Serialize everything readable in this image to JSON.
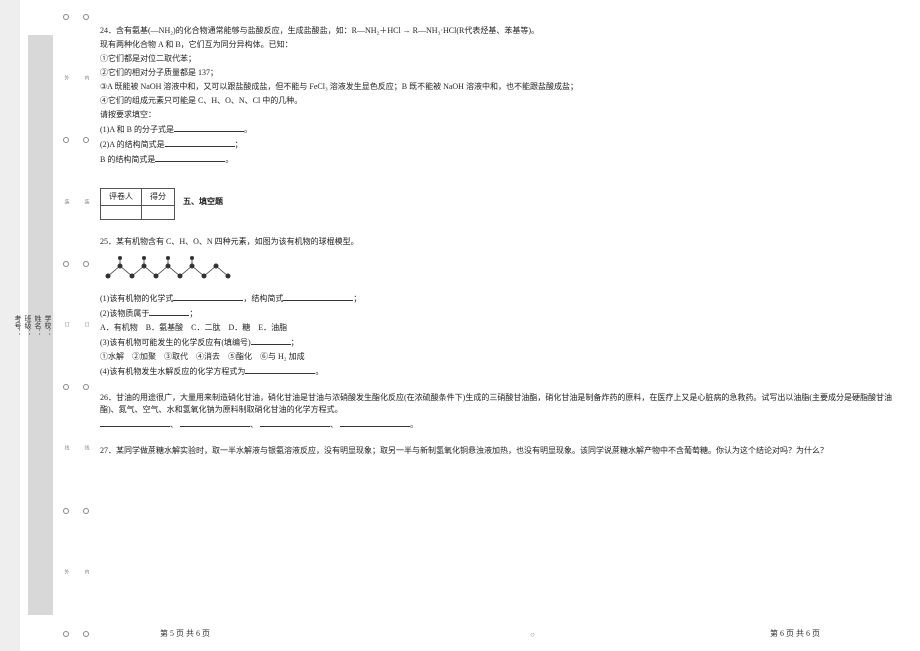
{
  "margin_labels": {
    "school": "学校：",
    "name": "姓名：",
    "class": "班级：",
    "exam_no": "考号：",
    "fold_outer": "外",
    "fold_inner": "内",
    "cut_1": "装",
    "cut_2": "订",
    "cut_3": "线"
  },
  "q24": {
    "num": "24．",
    "stem1": "含有氨基(—NH₂)的化合物通常能够与盐酸反应，生成盐酸盐，如：R—NH₂＋HCl → R—NH₃·HCl(R代表烃基、苯基等)。",
    "stem2": "现有两种化合物 A 和 B，它们互为同分异构体。已知：",
    "c1": "①它们都是对位二取代苯；",
    "c2": "②它们的相对分子质量都是 137；",
    "c3": "③A 既能被 NaOH 溶液中和，又可以跟盐酸成盐，但不能与 FeCl₃ 溶液发生显色反应；B 既不能被 NaOH 溶液中和，也不能跟盐酸成盐；",
    "c4": "④它们的组成元素只可能是 C、H、O、N、Cl 中的几种。",
    "ask": "请按要求填空：",
    "p1": "(1)A 和 B 的分子式是",
    "p2a": "(2)A 的结构简式是",
    "p2b": "B 的结构简式是",
    "end": "。",
    "semi": "；"
  },
  "section5": {
    "reviewer": "评卷人",
    "score": "得分",
    "title": "五、填空题"
  },
  "q25": {
    "num": "25．",
    "stem": "某有机物含有 C、H、O、N 四种元素，如图为该有机物的球棍模型。",
    "p1a": "(1)该有机物的化学式",
    "p1b": "，结构简式",
    "p2": "(2)该物质属于",
    "opts": "A．有机物　B．氨基酸　C．二肽　D．糖　E．油脂",
    "p3": "(3)该有机物可能发生的化学反应有(填编号)",
    "opts2": "①水解　②加聚　③取代　④消去　⑤酯化　⑥与 H₂ 加成",
    "p4": "(4)该有机物发生水解反应的化学方程式为",
    "semi": "；",
    "period": "。",
    "colon": "："
  },
  "q26": {
    "num": "26．",
    "stem": "甘油的用途很广，大量用来制造硝化甘油，硝化甘油是甘油与浓硝酸发生酯化反应(在浓硫酸条件下)生成的三硝酸甘油酯，硝化甘油是制备炸药的原料，在医疗上又是心脏病的急救药。试写出以油脂(主要成分是硬脂酸甘油酯)、氮气、空气、水和氢氧化钠为原料制取硝化甘油的化学方程式。",
    "blanks_sep": "、"
  },
  "q27": {
    "num": "27．",
    "stem": "某同学做蔗糖水解实验时，取一半水解液与银氨溶液反应，没有明显现象；取另一半与新制氢氧化铜悬浊液加热，也没有明显现象。该同学说蔗糖水解产物中不含葡萄糖。你认为这个结论对吗？为什么？"
  },
  "footer": {
    "left": "第 5 页  共 6 页",
    "right": "第 6 页  共 6 页",
    "circle": "○"
  }
}
